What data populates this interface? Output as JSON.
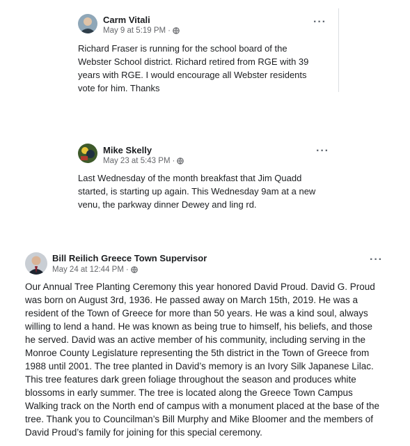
{
  "posts": [
    {
      "author": "Carm Vitali",
      "date": "May 9 at 5:19 PM",
      "separator": "·",
      "more": "···",
      "text": "Richard Fraser is running for the school board of the Webster School district. Richard retired from RGE with 39 years with RGE. I would encourage all Webster residents vote for him. Thanks"
    },
    {
      "author": "Mike Skelly",
      "date": "May 23 at 5:43 PM",
      "separator": "·",
      "more": "···",
      "text": "Last Wednesday of the month breakfast that Jim Quadd started, is starting up again. This Wednesday 9am at a new venu, the parkway dinner Dewey and ling rd."
    },
    {
      "author": "Bill Reilich Greece Town Supervisor",
      "date": "May 24 at 12:44 PM",
      "separator": "·",
      "more": "···",
      "text": "Our Annual Tree Planting Ceremony this year honored David Proud. David G. Proud was born on August 3rd, 1936. He passed away on March 15th, 2019. He was a resident of the Town of Greece for more than 50 years. He was a kind soul, always willing to lend a hand. He was known as being true to himself, his beliefs, and those he served. David was an active member of his community, including serving in the Monroe County Legislature representing the 5th district in the Town of Greece from 1988 until 2001. The tree planted in David’s memory is an Ivory Silk Japanese Lilac. This tree features dark green foliage throughout the season and produces white blossoms in early summer. The tree is located along the Greece Town Campus Walking track on the North end of campus with a monument placed at the base of the tree. Thank you to Councilman’s Bill Murphy and Mike Bloomer and the members of David Proud’s family for joining for this special ceremony."
    }
  ]
}
